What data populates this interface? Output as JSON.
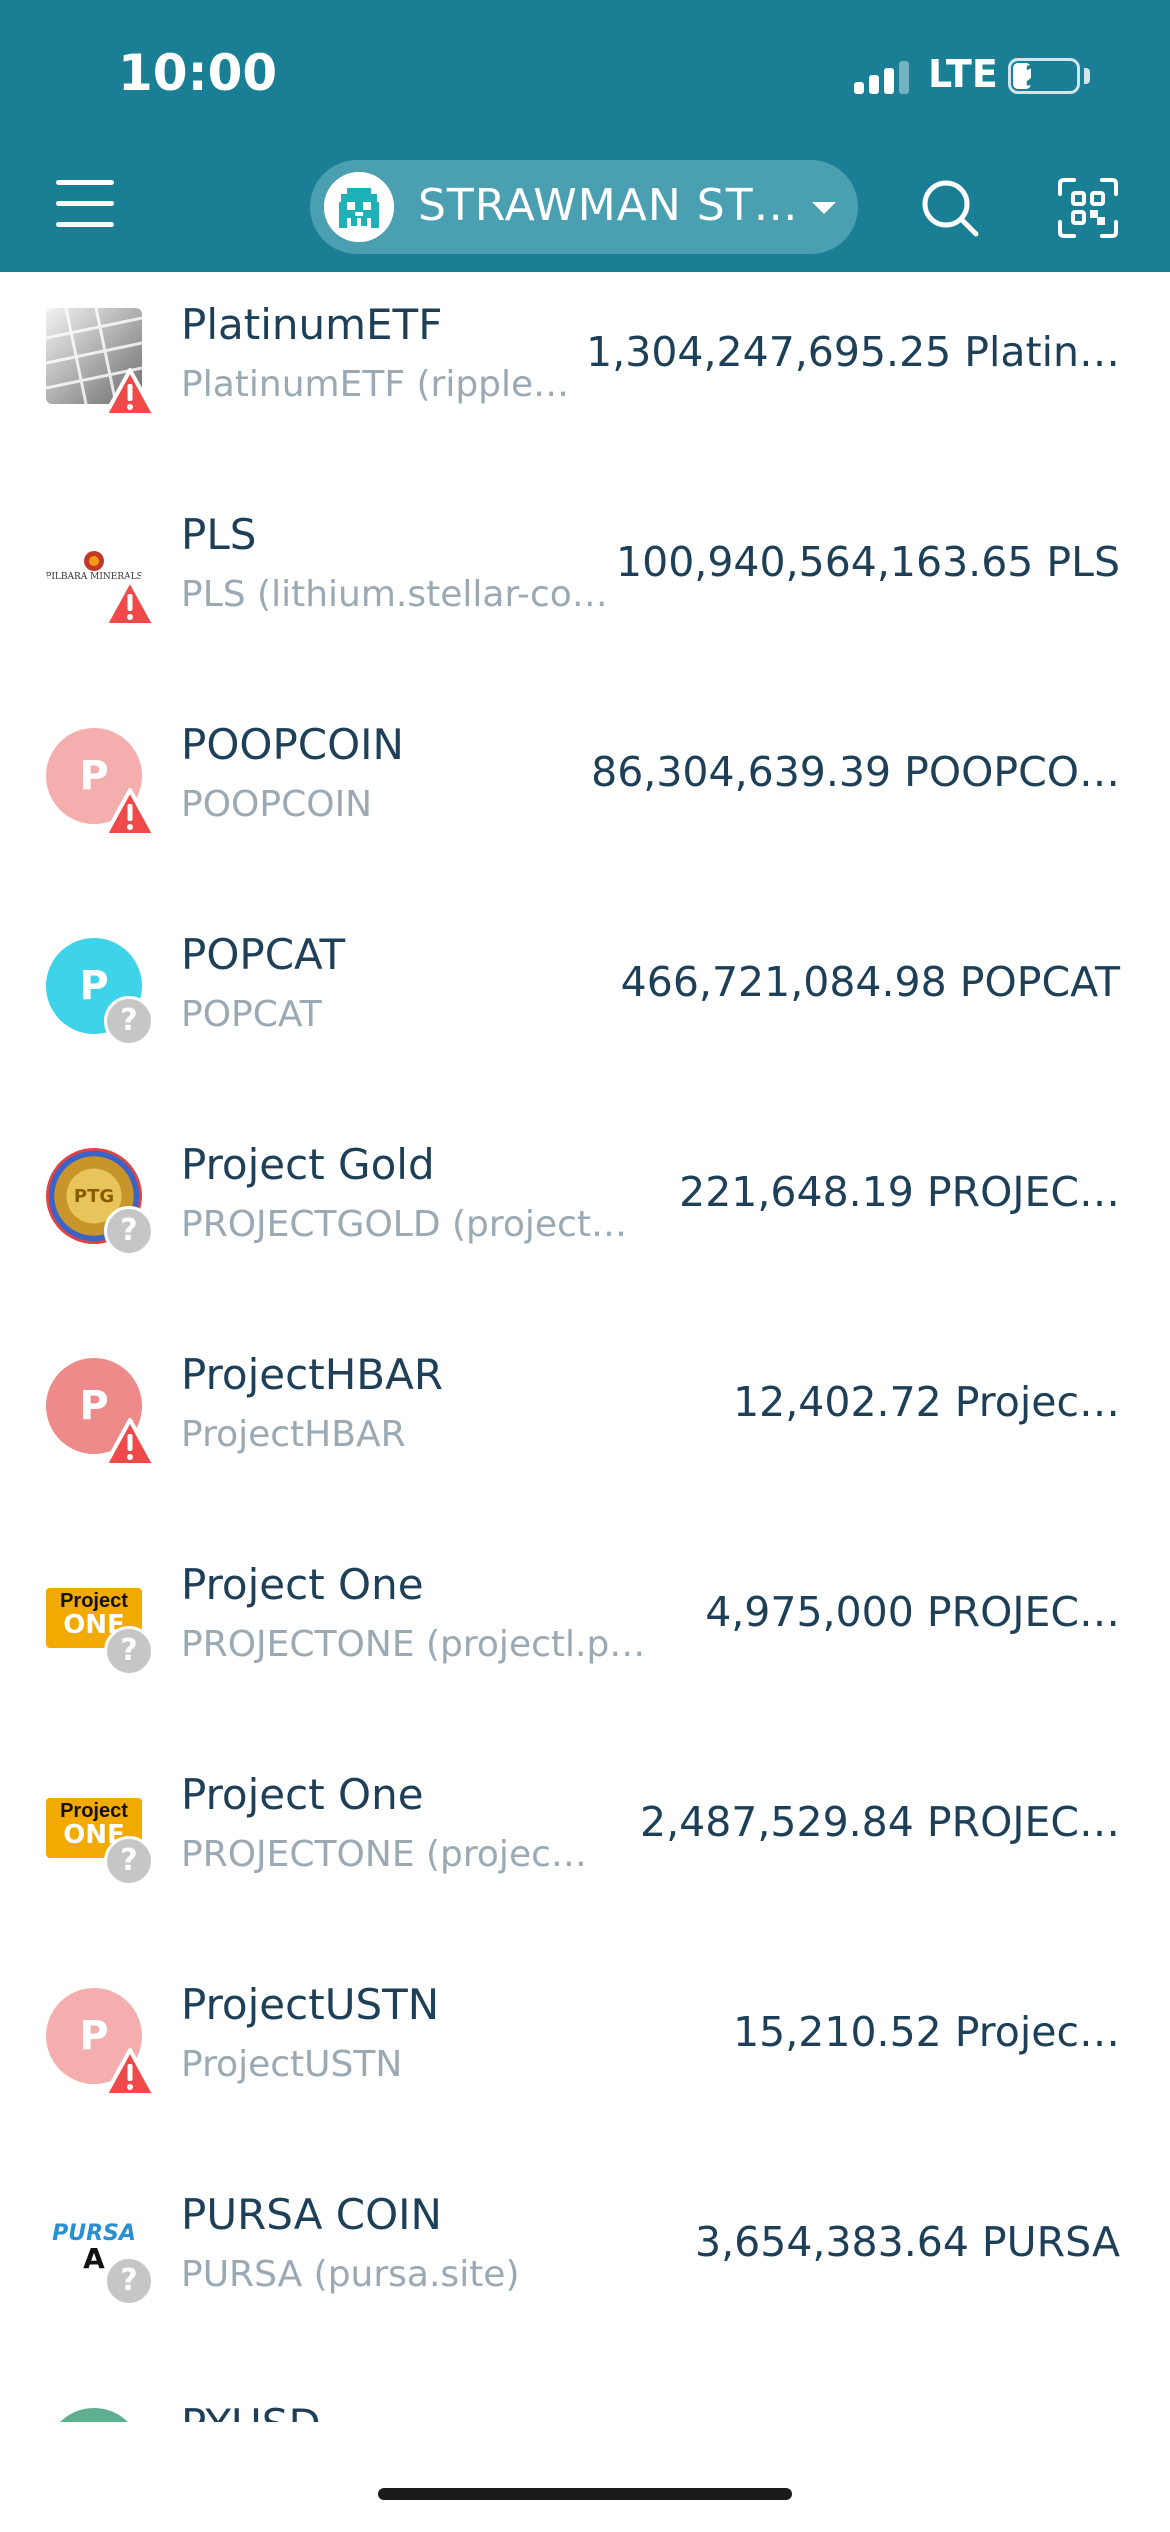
{
  "status_bar": {
    "time": "10:00",
    "network": "LTE",
    "battery": "27"
  },
  "header": {
    "account_name": "STRAWMAN ST…"
  },
  "tokens": [
    {
      "name": "PlatinumETF",
      "subtitle": "PlatinumETF (ripple…",
      "balance": "1,304,247,695.25 Platin…",
      "logo_type": "image",
      "logo_text": "",
      "logo_color": "#888888",
      "badge": "warning"
    },
    {
      "name": "PLS",
      "subtitle": "PLS (lithium.stellar-co…",
      "balance": "100,940,564,163.65 PLS",
      "logo_type": "image",
      "logo_text": "PILBARA MINERALS",
      "logo_color": "#ffffff",
      "badge": "warning"
    },
    {
      "name": "POOPCOIN",
      "subtitle": "POOPCOIN",
      "balance": "86,304,639.39 POOPCO…",
      "logo_type": "letter",
      "logo_text": "P",
      "logo_color": "#f4aeae",
      "badge": "warning"
    },
    {
      "name": "POPCAT",
      "subtitle": "POPCAT",
      "balance": "466,721,084.98 POPCAT",
      "logo_type": "letter",
      "logo_text": "P",
      "logo_color": "#3fd3ea",
      "badge": "unknown"
    },
    {
      "name": "Project Gold",
      "subtitle": "PROJECTGOLD (project…",
      "balance": "221,648.19 PROJEC…",
      "logo_type": "image",
      "logo_text": "PTG",
      "logo_color": "#d9a93a",
      "badge": "unknown"
    },
    {
      "name": "ProjectHBAR",
      "subtitle": "ProjectHBAR",
      "balance": "12,402.72 Projec…",
      "logo_type": "letter",
      "logo_text": "P",
      "logo_color": "#ee8a8a",
      "badge": "warning"
    },
    {
      "name": "Project One",
      "subtitle": "PROJECTONE (projectl.p…",
      "balance": "4,975,000 PROJEC…",
      "logo_type": "image",
      "logo_text": "Project",
      "logo_color": "#f2a900",
      "badge": "unknown"
    },
    {
      "name": "Project One",
      "subtitle": "PROJECTONE (projec…",
      "balance": "2,487,529.84 PROJEC…",
      "logo_type": "image",
      "logo_text": "Project",
      "logo_color": "#f2a900",
      "badge": "unknown"
    },
    {
      "name": "ProjectUSTN",
      "subtitle": "ProjectUSTN",
      "balance": "15,210.52 Projec…",
      "logo_type": "letter",
      "logo_text": "P",
      "logo_color": "#f4aeae",
      "badge": "warning"
    },
    {
      "name": "PURSA COIN",
      "subtitle": "PURSA (pursa.site)",
      "balance": "3,654,383.64 PURSA",
      "logo_type": "image",
      "logo_text": "PURSA",
      "logo_color": "#ffffff",
      "badge": "unknown"
    },
    {
      "name": "PYUSD",
      "subtitle": "",
      "balance": "",
      "logo_type": "letter",
      "logo_text": "",
      "logo_color": "#5fae8f",
      "badge": "none"
    }
  ],
  "colors": {
    "header_bg": "#1a7f95",
    "warning": "#ef4a4a",
    "unknown_badge": "#c6c6c6"
  }
}
